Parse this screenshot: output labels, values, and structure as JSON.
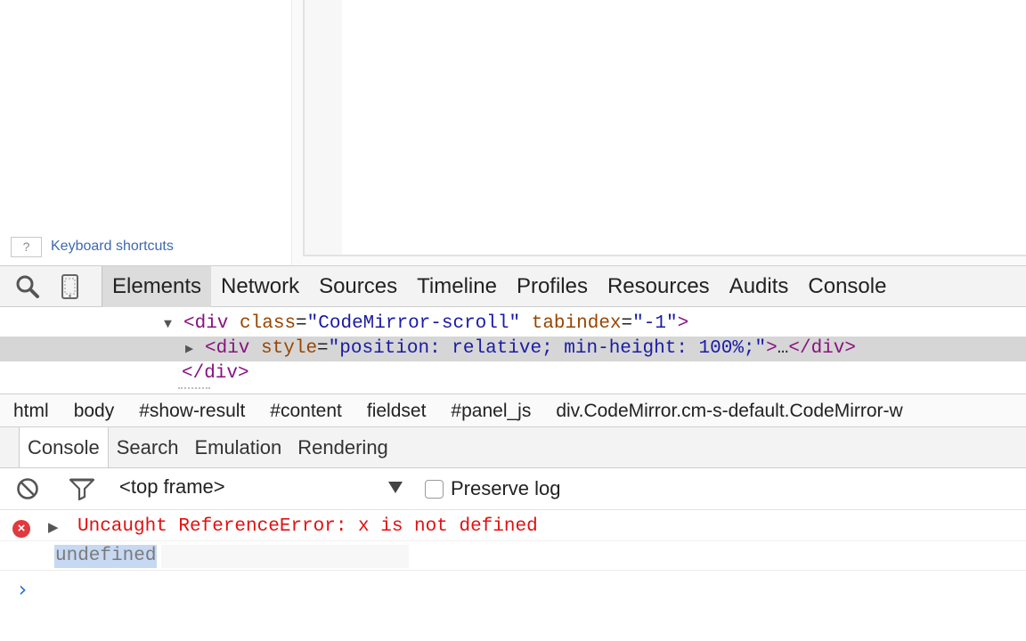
{
  "page": {
    "help_key": "?",
    "keyboard_shortcuts": "Keyboard shortcuts"
  },
  "toolbar": {
    "icons": [
      "search-icon",
      "device-mode-icon"
    ],
    "tabs": [
      {
        "label": "Elements",
        "active": true
      },
      {
        "label": "Network",
        "active": false
      },
      {
        "label": "Sources",
        "active": false
      },
      {
        "label": "Timeline",
        "active": false
      },
      {
        "label": "Profiles",
        "active": false
      },
      {
        "label": "Resources",
        "active": false
      },
      {
        "label": "Audits",
        "active": false
      },
      {
        "label": "Console",
        "active": false
      }
    ]
  },
  "dom_tree": {
    "line1": {
      "open": "<div",
      "attr1_name": "class",
      "attr1_value": "\"CodeMirror-scroll\"",
      "attr2_name": "tabindex",
      "attr2_value": "\"-1\"",
      "close": ">"
    },
    "line2": {
      "open": "<div",
      "attr_name": "style",
      "attr_value": "\"position: relative; min-height: 100%;\"",
      "close": ">",
      "ellipsis": "…",
      "end_tag": "</div>"
    },
    "line3": {
      "end_tag": "</div>"
    }
  },
  "breadcrumb": [
    "html",
    "body",
    "#show-result",
    "#content",
    "fieldset",
    "#panel_js",
    "div.CodeMirror.cm-s-default.CodeMirror-w"
  ],
  "drawer": {
    "tabs": [
      {
        "label": "Console",
        "active": true
      },
      {
        "label": "Search",
        "active": false
      },
      {
        "label": "Emulation",
        "active": false
      },
      {
        "label": "Rendering",
        "active": false
      }
    ]
  },
  "console_toolbar": {
    "icons": [
      "clear-console-icon",
      "filter-icon"
    ],
    "frame": "<top frame>",
    "preserve_log_label": "Preserve log",
    "preserve_log_checked": false
  },
  "console": {
    "error_message": "Uncaught ReferenceError: x is not defined",
    "result": "undefined",
    "prompt": "›"
  },
  "colors": {
    "error": "#e11010",
    "tag": "#881280",
    "attr_name": "#994500",
    "attr_value": "#1a1aa6",
    "link": "#3f68b0",
    "prompt": "#2f6fd6"
  }
}
